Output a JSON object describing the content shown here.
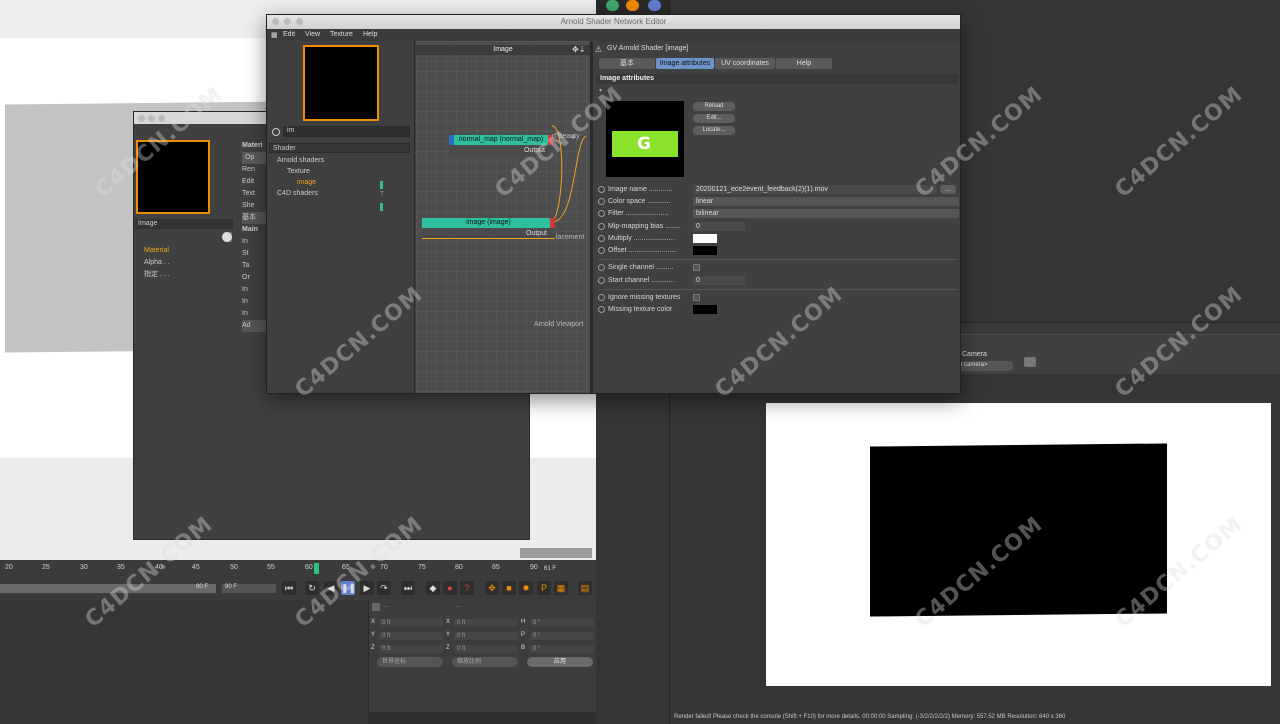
{
  "arnold_window": {
    "title": "Arnold Shader Network Editor",
    "menu": [
      "Edit",
      "View",
      "Texture",
      "Help"
    ],
    "search_value": "im",
    "shader_header": "Shader",
    "tree": {
      "arnold_shaders": "Arnold shaders",
      "texture": "Texture",
      "image": "image",
      "c4d_shaders": "C4D shaders",
      "image_marker": "T"
    },
    "graph": {
      "header": "Image",
      "nodes": {
        "normal_map": {
          "title": "normal_map (normal_map)",
          "output": "Output",
          "color": "#2fbf9f"
        },
        "image": {
          "title": "image (image)",
          "output": "Output",
          "color": "#2fbf9f"
        }
      },
      "ports": [
        "d Beauty",
        "lacement",
        "Arnold Viewport"
      ]
    },
    "props": {
      "title": "GV Arnold Shader [image]",
      "tabs": [
        "基本",
        "Image attributes",
        "UV coordinates",
        "Help"
      ],
      "active_tab": "Image attributes",
      "section": "Image attributes",
      "buttons": [
        "Reload",
        "Edit...",
        "Locate..."
      ],
      "fields": {
        "image_name_label": "Image name ............",
        "image_name_value": "20200121_ece2event_feedback(2)(1).mov",
        "browse": "...",
        "color_space_label": "Color space ............",
        "color_space_value": "linear",
        "filter_label": "Filter ......................",
        "filter_value": "bilinear",
        "mip_label": "Mip-mapping bias ........",
        "mip_value": "0",
        "multiply_label": "Multiply .....................",
        "offset_label": "Offset .........................",
        "single_channel_label": "Single channel .........",
        "start_channel_label": "Start channel ............",
        "start_channel_value": "0",
        "ignore_missing_label": "Ignore missing textures",
        "missing_color_label": "Missing texture color"
      },
      "colors": {
        "multiply": "#ffffff",
        "offset": "#000000",
        "missing": "#000000"
      }
    }
  },
  "material_window": {
    "name": "Image",
    "list": [
      "Material",
      "Alpha . .",
      "指定 . . ."
    ],
    "right_labels": [
      "Materi",
      "Op",
      "Ren",
      "Edit",
      "Text",
      "She",
      "基本",
      "Main",
      "In",
      "St",
      "Ta",
      "Or",
      "In",
      "In",
      "In",
      "Ad"
    ]
  },
  "timeline": {
    "ticks": [
      "20",
      "25",
      "30",
      "35",
      "40",
      "45",
      "50",
      "55",
      "60",
      "65",
      "70",
      "75",
      "80",
      "85",
      "90"
    ],
    "current_frame": "61 F",
    "end_frame_bar": "90 F",
    "end_frame_field": "90 F"
  },
  "coordinates": {
    "rows": [
      {
        "a": "X",
        "av": "0 ft",
        "b": "X",
        "bv": "0 ft",
        "c": "H",
        "cv": "0 °"
      },
      {
        "a": "Y",
        "av": "0 ft",
        "b": "Y",
        "bv": "0 ft",
        "c": "P",
        "cv": "0 °"
      },
      {
        "a": "Z",
        "av": "0 ft",
        "b": "Z",
        "bv": "0 ft",
        "c": "B",
        "cv": "0 °"
      }
    ],
    "header_a": "---",
    "header_b": "---",
    "drop_world": "世界坐标",
    "drop_scale": "缩放比例",
    "apply": "应用"
  },
  "render": {
    "camera_label": "Camera",
    "camera_value": "e camera>",
    "status": "Render failed! Please check the console (Shift + F10) for more details.   00:00:00  Sampling: (-3/2/2/2/2/2)  Memory: 557.52 MB  Resolution: 640 x 360"
  },
  "watermark_text": "C4DCN.COM"
}
